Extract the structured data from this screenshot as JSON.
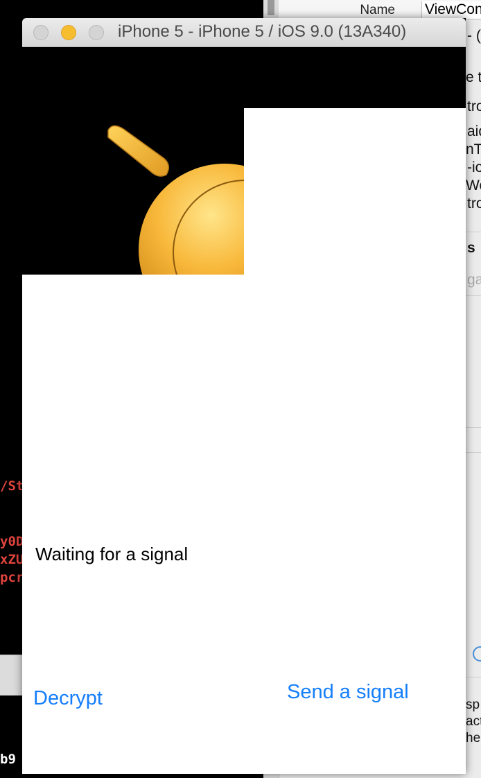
{
  "inspector": {
    "name_label": "Name",
    "name_value": "ViewContr",
    "fragments": [
      "- (",
      "e t",
      "tro",
      "aid",
      "nT",
      "-io",
      "Wo",
      "tro",
      "s",
      "ga",
      "sp",
      "act",
      "he"
    ]
  },
  "console": {
    "lines": [
      "/St",
      "y0D",
      "xZU",
      "pcr",
      "b9"
    ]
  },
  "window": {
    "title": "iPhone 5 - iPhone 5 / iOS 9.0 (13A340)"
  },
  "app": {
    "status_text": "Waiting for a signal",
    "decrypt_label": "Decrypt",
    "send_label": "Send a signal"
  },
  "colors": {
    "accent": "#157efb",
    "teapot": "#f8b83a",
    "console_red": "#e0443e"
  }
}
